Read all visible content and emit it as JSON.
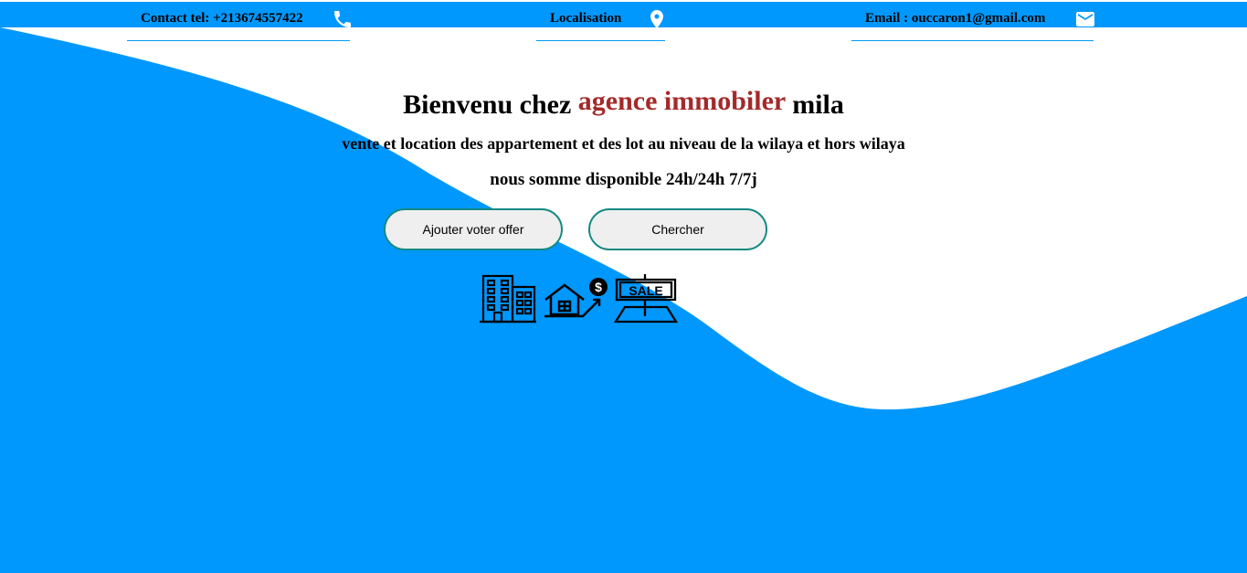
{
  "header": {
    "phone": {
      "text": "Contact tel: +213674557422",
      "icon": "phone-icon"
    },
    "location": {
      "text": "Localisation",
      "icon": "location-pin-icon"
    },
    "email": {
      "text": "Email : ouccaron1@gmail.com",
      "icon": "mail-icon"
    }
  },
  "hero": {
    "title_prefix": "Bienvenu chez",
    "title_accent": "agence immobiler",
    "title_suffix": "mila",
    "subtitle": "vente et location des appartement et des lot au niveau de la wilaya et hors wilaya",
    "availability": "nous somme disponible 24h/24h 7/7j"
  },
  "actions": {
    "add_offer": "Ajouter voter offer",
    "search": "Chercher"
  },
  "illustrations": [
    "building-icon",
    "house-price-icon",
    "sale-sign-icon"
  ],
  "colors": {
    "primary": "#0098fd",
    "accent": "#a52a2a",
    "button_border": "#148a82",
    "button_bg": "#efefef"
  }
}
